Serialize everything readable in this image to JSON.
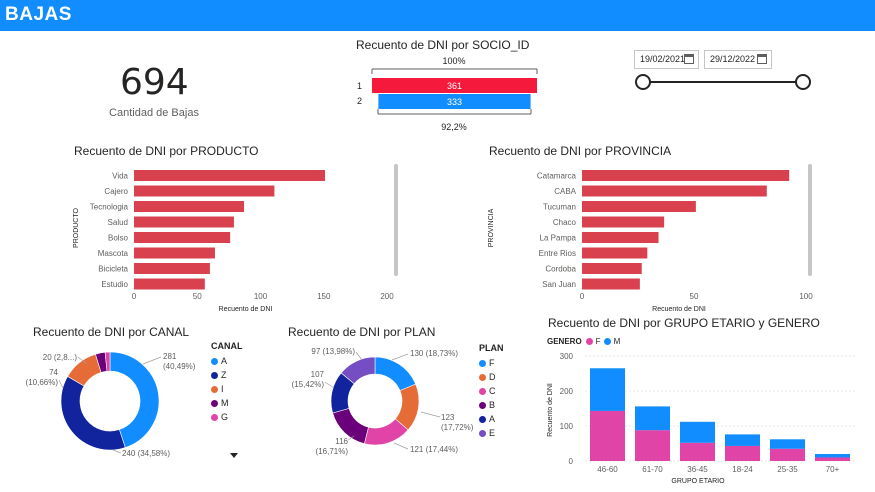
{
  "header": {
    "title": "BAJAS"
  },
  "kpi": {
    "value": "694",
    "label": "Cantidad de Bajas"
  },
  "date_filter": {
    "start": "19/02/2021",
    "end": "29/12/2022"
  },
  "socio_chart": {
    "title": "Recuento de DNI por SOCIO_ID",
    "top_label": "100%",
    "bottom_label": "92,2%",
    "categories": [
      "1",
      "2"
    ],
    "values": [
      361,
      333
    ],
    "colors": [
      "#F5193C",
      "#118DFF"
    ]
  },
  "colors": {
    "header": "#118DFF",
    "bar": "#D9414F"
  },
  "chart_data": [
    {
      "type": "bar",
      "id": "producto",
      "title": "Recuento de DNI por PRODUCTO",
      "ylabel": "PRODUCTO",
      "xlabel": "Recuento de DNI",
      "categories": [
        "Vida",
        "Cajero",
        "Tecnologia",
        "Salud",
        "Bolso",
        "Mascota",
        "Bicicleta",
        "Estudio"
      ],
      "values": [
        151,
        111,
        87,
        79,
        76,
        64,
        60,
        56
      ],
      "xlim": [
        0,
        200
      ],
      "xticks": [
        "0",
        "50",
        "100",
        "150",
        "200"
      ]
    },
    {
      "type": "bar",
      "id": "provincia",
      "title": "Recuento de DNI por PROVINCIA",
      "ylabel": "PROVINCIA",
      "xlabel": "Recuento de DNI",
      "categories": [
        "Catamarca",
        "CABA",
        "Tucuman",
        "Chaco",
        "La Pampa",
        "Entre Rios",
        "Cordoba",
        "San Juan"
      ],
      "values": [
        111,
        99,
        61,
        44,
        41,
        35,
        32,
        31
      ],
      "xlim": [
        0,
        120
      ],
      "xticks": [
        "0",
        "50",
        "100"
      ]
    },
    {
      "type": "pie",
      "id": "canal",
      "title": "Recuento de DNI por CANAL",
      "legend_title": "CANAL",
      "categories": [
        "A",
        "Z",
        "I",
        "M",
        "G"
      ],
      "values": [
        281,
        240,
        74,
        20,
        10
      ],
      "colors": [
        "#118DFF",
        "#12239E",
        "#E66C37",
        "#6B007B",
        "#E044A7"
      ],
      "labels": [
        "281\n(40,49%)",
        "240 (34,58%)",
        "74\n(10,66%)",
        "20 (2,8...)"
      ]
    },
    {
      "type": "pie",
      "id": "plan",
      "title": "Recuento de DNI por PLAN",
      "legend_title": "PLAN",
      "categories": [
        "F",
        "D",
        "C",
        "B",
        "A",
        "E"
      ],
      "values": [
        130,
        123,
        121,
        116,
        107,
        97
      ],
      "colors": [
        "#118DFF",
        "#E66C37",
        "#E044A7",
        "#6B007B",
        "#12239E",
        "#744EC2"
      ],
      "labels": [
        "130 (18,73%)",
        "123\n(17,72%)",
        "121 (17,44%)",
        "116\n(16,71%)",
        "107\n(15,42%)",
        "97 (13,98%)"
      ]
    },
    {
      "type": "bar",
      "id": "grupo",
      "title": "Recuento de DNI por GRUPO ETARIO y GENERO",
      "legend_title": "GENERO",
      "xlabel": "GRUPO ETARIO",
      "ylabel": "Recuento de DNI",
      "categories": [
        "46-60",
        "61-70",
        "36-45",
        "18-24",
        "25-35",
        "70+"
      ],
      "series": [
        {
          "name": "F",
          "color": "#E044A7",
          "values": [
            143,
            88,
            52,
            43,
            35,
            10
          ]
        },
        {
          "name": "M",
          "color": "#118DFF",
          "values": [
            122,
            68,
            60,
            33,
            27,
            10
          ]
        }
      ],
      "ylim": [
        0,
        300
      ],
      "yticks": [
        "0",
        "100",
        "200",
        "300"
      ]
    }
  ]
}
